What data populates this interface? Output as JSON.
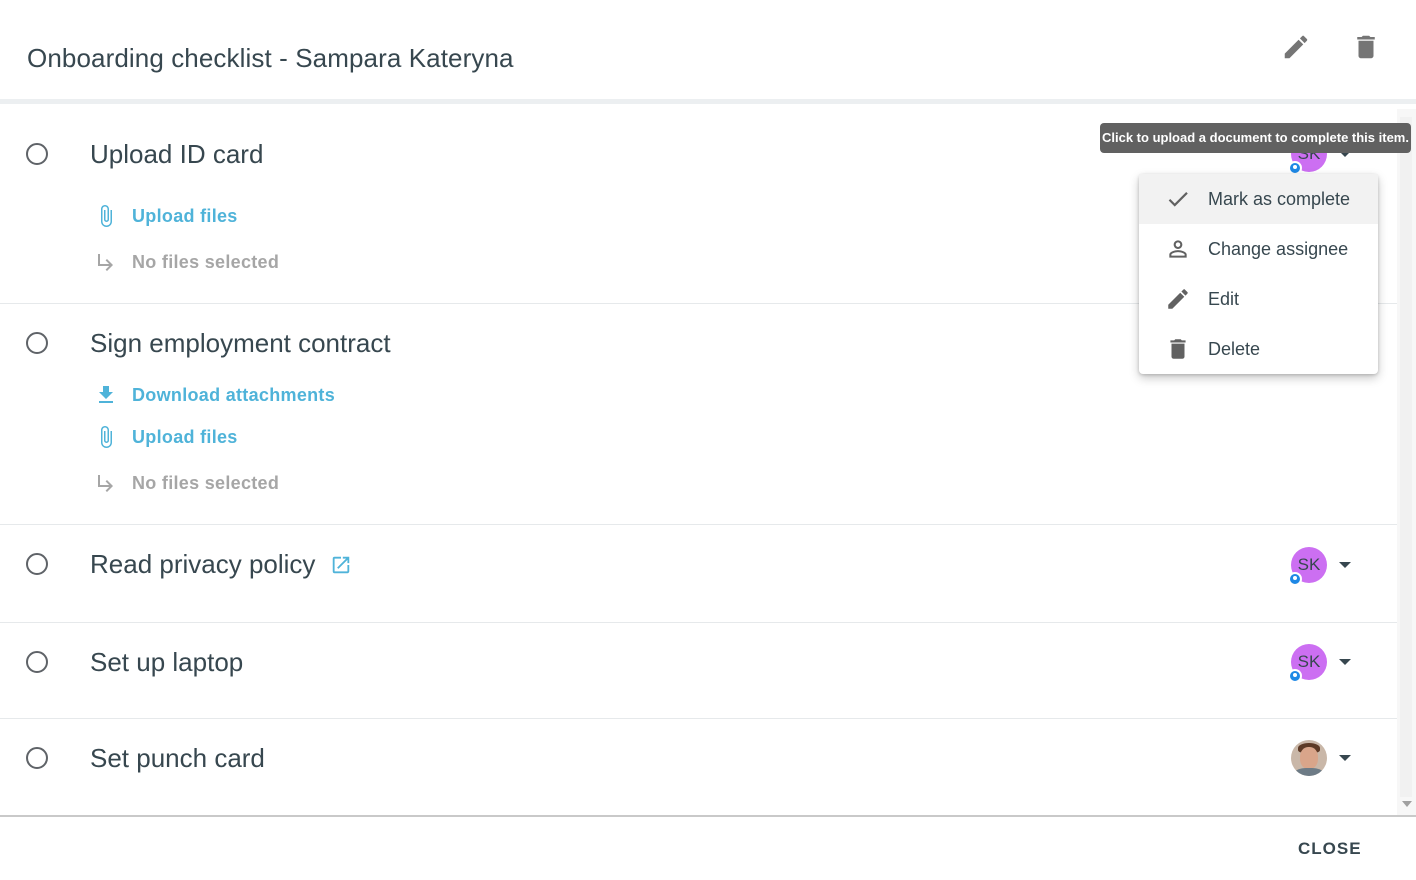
{
  "dialog": {
    "title": "Onboarding checklist - Sampara Kateryna",
    "edit_icon": "pencil-icon",
    "delete_icon": "trash-icon"
  },
  "tooltip": "Click to upload a document to complete this item.",
  "items": [
    {
      "title": "Upload ID card",
      "upload_label": "Upload files",
      "no_files_label": "No files selected",
      "assignee": "SK"
    },
    {
      "title": "Sign employment contract",
      "download_label": "Download attachments",
      "upload_label": "Upload files",
      "no_files_label": "No files selected"
    },
    {
      "title": "Read privacy policy",
      "link_icon": "external-link-icon",
      "assignee": "SK"
    },
    {
      "title": "Set up laptop",
      "assignee": "SK"
    },
    {
      "title": "Set punch card",
      "assignee_icon": "user-photo-avatar"
    }
  ],
  "menu": {
    "items": [
      {
        "label": "Mark as complete",
        "icon": "check-icon"
      },
      {
        "label": "Change assignee",
        "icon": "person-icon"
      },
      {
        "label": "Edit",
        "icon": "pencil-icon"
      },
      {
        "label": "Delete",
        "icon": "trash-icon"
      }
    ]
  },
  "footer": {
    "close_label": "CLOSE"
  },
  "colors": {
    "accent_link": "#4fb3d9",
    "avatar_bg": "#cc6ff2",
    "badge": "#1e88e5",
    "text_primary": "#37474f"
  }
}
